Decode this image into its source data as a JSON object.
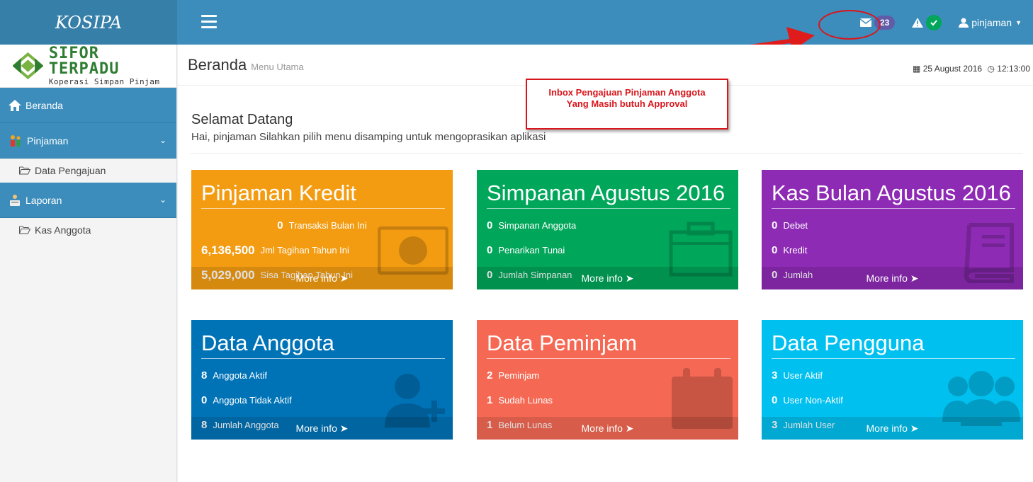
{
  "app": {
    "logo": "KOSIPA"
  },
  "brand": {
    "title": "SIFOR TERPADU",
    "subtitle": "Koperasi Simpan Pinjam"
  },
  "topbar": {
    "messages_count": "23",
    "user": "pinjaman"
  },
  "sidebar": {
    "items": [
      {
        "label": "Beranda"
      },
      {
        "label": "Pinjaman"
      },
      {
        "label": "Data Pengajuan"
      },
      {
        "label": "Laporan"
      },
      {
        "label": "Kas Anggota"
      }
    ]
  },
  "header": {
    "title": "Beranda",
    "subtitle": "Menu Utama",
    "date": "25 August 2016",
    "time": "12:13:00"
  },
  "welcome": {
    "title": "Selamat Datang",
    "text": "Hai, pinjaman Silahkan pilih menu disamping untuk mengoprasikan aplikasi"
  },
  "annotation": {
    "line1": "Inbox Pengajuan Pinjaman Anggota",
    "line2": "Yang Masih butuh Approval"
  },
  "boxes": [
    {
      "title": "Pinjaman Kredit",
      "color": "#f39c12",
      "rows": [
        {
          "value": "0",
          "label": "Transaksi Bulan Ini"
        },
        {
          "value": "6,136,500",
          "label": "Jml Tagihan Tahun Ini"
        },
        {
          "value": "5,029,000",
          "label": "Sisa Tagihan Tahun Ini"
        }
      ],
      "more": "More info"
    },
    {
      "title": "Simpanan Agustus 2016",
      "color": "#00a65a",
      "rows": [
        {
          "value": "0",
          "label": "Simpanan Anggota"
        },
        {
          "value": "0",
          "label": "Penarikan Tunai"
        },
        {
          "value": "0",
          "label": "Jumlah Simpanan"
        }
      ],
      "more": "More info"
    },
    {
      "title": "Kas Bulan Agustus 2016",
      "color": "#8e2bb5",
      "rows": [
        {
          "value": "0",
          "label": "Debet"
        },
        {
          "value": "0",
          "label": "Kredit"
        },
        {
          "value": "0",
          "label": "Jumlah"
        }
      ],
      "more": "More info"
    },
    {
      "title": "Data Anggota",
      "color": "#0073b7",
      "rows": [
        {
          "value": "8",
          "label": "Anggota Aktif"
        },
        {
          "value": "0",
          "label": "Anggota Tidak Aktif"
        },
        {
          "value": "8",
          "label": "Jumlah Anggota"
        }
      ],
      "more": "More info"
    },
    {
      "title": "Data Peminjam",
      "color": "#f56954",
      "rows": [
        {
          "value": "2",
          "label": "Peminjam"
        },
        {
          "value": "1",
          "label": "Sudah Lunas"
        },
        {
          "value": "1",
          "label": "Belum Lunas"
        }
      ],
      "more": "More info"
    },
    {
      "title": "Data Pengguna",
      "color": "#00c0ef",
      "rows": [
        {
          "value": "3",
          "label": "User Aktif"
        },
        {
          "value": "0",
          "label": "User Non-Aktif"
        },
        {
          "value": "3",
          "label": "Jumlah User"
        }
      ],
      "more": "More info"
    }
  ]
}
